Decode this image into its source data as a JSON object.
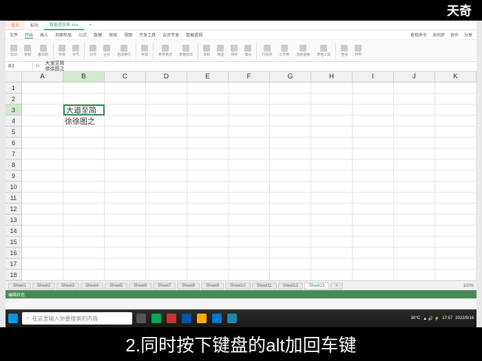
{
  "brand": "天奇",
  "tabs": {
    "home": "首页",
    "doc": "稻壳",
    "file": "数据透视表.xlsx"
  },
  "menu": {
    "file": "文件",
    "start": "开始",
    "insert": "插入",
    "layout": "页面布局",
    "formula": "公式",
    "data": "数据",
    "review": "审阅",
    "view": "视图",
    "dev": "开发工具",
    "member": "会员专享",
    "pivot": "数据透视",
    "r1": "查找命令",
    "r2": "未同步",
    "r3": "协作",
    "r4": "分享"
  },
  "ribbon": {
    "g1": "剪切",
    "g2": "复制",
    "g3": "格式刷",
    "g4": "字体",
    "g5": "字号",
    "g6": "对齐",
    "g7": "合并",
    "g8": "自动换行",
    "g9": "常规",
    "g10": "条件格式",
    "g11": "表格样式",
    "g12": "求和",
    "g13": "筛选",
    "g14": "排序",
    "g15": "填充",
    "g16": "行和列",
    "g17": "工作表",
    "g18": "冻结窗格",
    "g19": "表格工具",
    "g20": "查找",
    "g21": "符号"
  },
  "namebox": "B3",
  "formula_lines": {
    "l1": "大道至简",
    "l2": "徐徐图之"
  },
  "cols": [
    "A",
    "B",
    "C",
    "D",
    "E",
    "F",
    "G",
    "H",
    "I",
    "J",
    "K"
  ],
  "cells": {
    "b3": "大道至简",
    "b4": "徐徐图之"
  },
  "sheets": {
    "s1": "Sheet1",
    "s2": "Sheet2",
    "s3": "Sheet3",
    "s4": "Sheet4",
    "s5": "Sheet5",
    "s6": "Sheet6",
    "s7": "Sheet7",
    "s8": "Sheet8",
    "s9": "Sheet9",
    "s10": "Sheet10",
    "s11": "Sheet11",
    "s12": "Sheet12",
    "s13": "Sheet13",
    "zoom": "100%"
  },
  "status": "编辑状态",
  "search": "在这里输入你要搜索的内容",
  "tray": {
    "temp": "30°C",
    "time": "17:57",
    "date": "2022/5/16"
  },
  "subtitle": "2.同时按下键盘的alt加回车键"
}
